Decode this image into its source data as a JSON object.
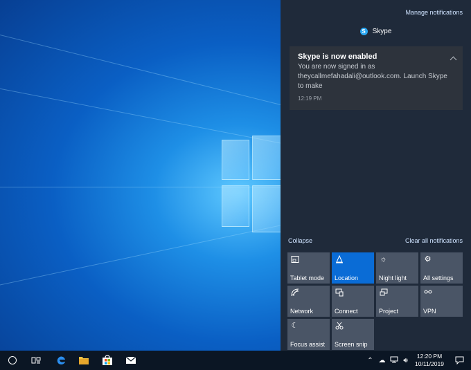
{
  "action_center": {
    "manage_notifications": "Manage notifications",
    "app_name": "Skype",
    "notification": {
      "title": "Skype is now enabled",
      "body": "You are now signed in as theycallmefahadali@outlook.com. Launch Skype to make",
      "time": "12:19 PM"
    },
    "collapse": "Collapse",
    "clear_all": "Clear all notifications",
    "tiles": [
      {
        "label": "Tablet mode",
        "icon": "tablet-icon",
        "active": false
      },
      {
        "label": "Location",
        "icon": "location-icon",
        "active": true
      },
      {
        "label": "Night light",
        "icon": "sun-icon",
        "active": false
      },
      {
        "label": "All settings",
        "icon": "gear-icon",
        "active": false
      },
      {
        "label": "Network",
        "icon": "network-icon",
        "active": false
      },
      {
        "label": "Connect",
        "icon": "connect-icon",
        "active": false
      },
      {
        "label": "Project",
        "icon": "project-icon",
        "active": false
      },
      {
        "label": "VPN",
        "icon": "vpn-icon",
        "active": false
      },
      {
        "label": "Focus assist",
        "icon": "moon-icon",
        "active": false
      },
      {
        "label": "Screen snip",
        "icon": "scissors-icon",
        "active": false
      }
    ]
  },
  "taskbar": {
    "time": "12:20 PM",
    "date": "10/11/2019"
  },
  "colors": {
    "accent": "#0a6cd6",
    "panel": "#1f2a3a",
    "tile": "#4a5566"
  }
}
